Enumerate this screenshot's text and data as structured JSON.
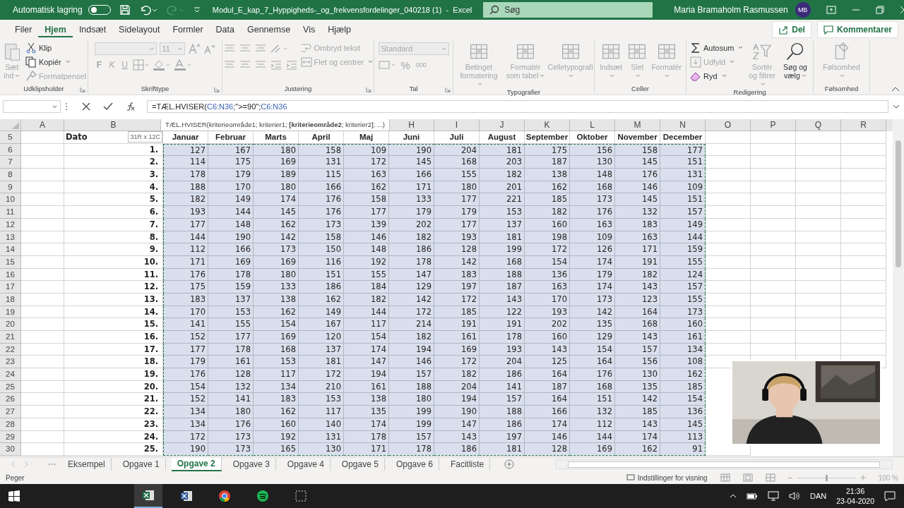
{
  "titlebar": {
    "autosave_label": "Automatisk lagring",
    "autosave_on": false,
    "title": "Modul_E_kap_7_Hyppigheds-_og_frekvensfordelinger_040218 (1)  -  Excel",
    "search_placeholder": "Søg",
    "user": "Maria Bramaholm Rasmussen",
    "avatar": "MB"
  },
  "tabs": [
    {
      "label": "Filer",
      "selected": false
    },
    {
      "label": "Hjem",
      "selected": true
    },
    {
      "label": "Indsæt",
      "selected": false
    },
    {
      "label": "Sidelayout",
      "selected": false
    },
    {
      "label": "Formler",
      "selected": false
    },
    {
      "label": "Data",
      "selected": false
    },
    {
      "label": "Gennemse",
      "selected": false
    },
    {
      "label": "Vis",
      "selected": false
    },
    {
      "label": "Hjælp",
      "selected": false
    }
  ],
  "share_button": "Del",
  "comments_button": "Kommentarer",
  "ribbon": [
    {
      "label": "Udklipsholder",
      "columns": [
        {
          "kind": "large-paste",
          "label": "Sæt ind",
          "disabled": true,
          "dropdown": true
        },
        {
          "kind": "stack",
          "items": [
            {
              "kind": "cut",
              "label": "Klip",
              "disabled": false,
              "dropdown": false
            },
            {
              "kind": "copy",
              "label": "Kopiér",
              "disabled": false,
              "dropdown": true
            },
            {
              "kind": "brush",
              "label": "Formatpensel",
              "disabled": true,
              "dropdown": false
            }
          ]
        }
      ]
    },
    {
      "label": "Skrifttype",
      "columns": [
        {
          "kind": "stack",
          "items": [
            {
              "kind": "font-row",
              "value": "11",
              "disabled": true
            },
            {
              "kind": "style-row",
              "glyphs": [
                "F",
                "K",
                "U"
              ],
              "disabled": true
            }
          ]
        }
      ]
    },
    {
      "label": "Justering",
      "columns": [
        {
          "kind": "stack",
          "items": [
            {
              "kind": "align-row",
              "disabled": true
            },
            {
              "kind": "align-row",
              "disabled": true
            }
          ]
        },
        {
          "kind": "stack",
          "items": [
            {
              "kind": "wrap",
              "label": "Ombryd tekst",
              "disabled": true,
              "dropdown": false
            },
            {
              "kind": "merge",
              "label": "Flet og centrer",
              "disabled": true,
              "dropdown": true
            }
          ]
        }
      ]
    },
    {
      "label": "Tal",
      "columns": [
        {
          "kind": "stack",
          "items": [
            {
              "kind": "field",
              "value": "Standard",
              "disabled": true
            },
            {
              "kind": "number-row",
              "glyphs": [
                "%",
                "000"
              ],
              "disabled": true
            }
          ]
        }
      ]
    },
    {
      "label": "Typografier",
      "columns": [
        {
          "kind": "large",
          "label": "Betinget formatering",
          "disabled": true,
          "dropdown": true
        },
        {
          "kind": "large",
          "label": "Formatér som tabel",
          "disabled": true,
          "dropdown": true
        },
        {
          "kind": "large",
          "label": "Celletypografi",
          "disabled": true,
          "dropdown": true
        }
      ]
    },
    {
      "label": "Celler",
      "columns": [
        {
          "kind": "large",
          "label": "Indsæt",
          "disabled": true,
          "dropdown": true
        },
        {
          "kind": "large",
          "label": "Slet",
          "disabled": true,
          "dropdown": true
        },
        {
          "kind": "large",
          "label": "Formatér",
          "disabled": true,
          "dropdown": true
        }
      ]
    },
    {
      "label": "Redigering",
      "columns": [
        {
          "kind": "stack",
          "items": [
            {
              "kind": "sum",
              "label": "Autosum",
              "disabled": false,
              "dropdown": true
            },
            {
              "kind": "fill",
              "label": "Udfyld",
              "disabled": true,
              "dropdown": true
            },
            {
              "kind": "eraser",
              "label": "Ryd",
              "disabled": false,
              "dropdown": true
            }
          ]
        },
        {
          "kind": "large-sort",
          "label": "Sortér og filtrer",
          "disabled": true,
          "dropdown": true
        },
        {
          "kind": "large-search",
          "label": "Søg og vælg",
          "disabled": false,
          "dropdown": true
        }
      ]
    },
    {
      "label": "Følsomhed",
      "columns": [
        {
          "kind": "large-tag",
          "label": "Følsomhed",
          "disabled": true,
          "dropdown": true
        }
      ]
    }
  ],
  "formula_bar": {
    "formula": [
      {
        "text": "=TÆL.HVISER(",
        "kind": "plain"
      },
      {
        "text": "C6:N36",
        "kind": "ref"
      },
      {
        "text": ";\">=90\";",
        "kind": "plain"
      },
      {
        "text": "C6:N36",
        "kind": "ref"
      }
    ],
    "tooltip": "TÆL.HVISER(kriterieområde1; kriterier1; **[kriterieområde2**; kriterier2]; ...)"
  },
  "column_headers_left": [
    "A",
    "B"
  ],
  "column_headers_right": [
    "H",
    "I",
    "J",
    "K",
    "L",
    "M",
    "N",
    "O",
    "P",
    "Q",
    "R"
  ],
  "header_row": {
    "num": "5",
    "label": "Dato",
    "size_hint": "31R x 12C",
    "months": [
      "Januar",
      "Februar",
      "Marts",
      "April",
      "Maj",
      "Juni",
      "Juli",
      "August",
      "September",
      "Oktober",
      "November",
      "December"
    ]
  },
  "rows": [
    {
      "num": "6",
      "day": "1.",
      "values": [
        "127",
        "167",
        "180",
        "158",
        "109",
        "190",
        "204",
        "181",
        "175",
        "156",
        "158",
        "177"
      ]
    },
    {
      "num": "7",
      "day": "2.",
      "values": [
        "114",
        "175",
        "169",
        "131",
        "172",
        "145",
        "168",
        "203",
        "187",
        "130",
        "145",
        "151"
      ]
    },
    {
      "num": "8",
      "day": "3.",
      "values": [
        "178",
        "179",
        "189",
        "115",
        "163",
        "166",
        "155",
        "182",
        "138",
        "148",
        "176",
        "131"
      ]
    },
    {
      "num": "9",
      "day": "4.",
      "values": [
        "188",
        "170",
        "180",
        "166",
        "162",
        "171",
        "180",
        "201",
        "162",
        "168",
        "146",
        "109"
      ]
    },
    {
      "num": "10",
      "day": "5.",
      "values": [
        "182",
        "149",
        "174",
        "176",
        "158",
        "133",
        "177",
        "221",
        "185",
        "173",
        "145",
        "151"
      ]
    },
    {
      "num": "11",
      "day": "6.",
      "values": [
        "193",
        "144",
        "145",
        "176",
        "177",
        "179",
        "179",
        "153",
        "182",
        "176",
        "132",
        "157"
      ]
    },
    {
      "num": "12",
      "day": "7.",
      "values": [
        "177",
        "148",
        "162",
        "173",
        "139",
        "202",
        "177",
        "137",
        "160",
        "163",
        "183",
        "149"
      ]
    },
    {
      "num": "13",
      "day": "8.",
      "values": [
        "144",
        "190",
        "142",
        "158",
        "146",
        "182",
        "193",
        "181",
        "198",
        "109",
        "163",
        "144"
      ]
    },
    {
      "num": "14",
      "day": "9.",
      "values": [
        "112",
        "166",
        "173",
        "150",
        "148",
        "186",
        "128",
        "199",
        "172",
        "126",
        "171",
        "159"
      ]
    },
    {
      "num": "15",
      "day": "10.",
      "values": [
        "171",
        "169",
        "169",
        "116",
        "192",
        "178",
        "142",
        "168",
        "154",
        "174",
        "191",
        "155"
      ]
    },
    {
      "num": "16",
      "day": "11.",
      "values": [
        "176",
        "178",
        "180",
        "151",
        "155",
        "147",
        "183",
        "188",
        "136",
        "179",
        "182",
        "124"
      ]
    },
    {
      "num": "17",
      "day": "12.",
      "values": [
        "175",
        "159",
        "133",
        "186",
        "184",
        "129",
        "197",
        "187",
        "163",
        "174",
        "143",
        "157"
      ]
    },
    {
      "num": "18",
      "day": "13.",
      "values": [
        "183",
        "137",
        "138",
        "162",
        "182",
        "142",
        "172",
        "143",
        "170",
        "173",
        "123",
        "155"
      ]
    },
    {
      "num": "19",
      "day": "14.",
      "values": [
        "170",
        "153",
        "162",
        "149",
        "144",
        "172",
        "185",
        "122",
        "193",
        "142",
        "164",
        "173"
      ]
    },
    {
      "num": "20",
      "day": "15.",
      "values": [
        "141",
        "155",
        "154",
        "167",
        "117",
        "214",
        "191",
        "191",
        "202",
        "135",
        "168",
        "160"
      ]
    },
    {
      "num": "21",
      "day": "16.",
      "values": [
        "152",
        "177",
        "169",
        "120",
        "154",
        "182",
        "161",
        "178",
        "160",
        "129",
        "143",
        "161"
      ]
    },
    {
      "num": "22",
      "day": "17.",
      "values": [
        "177",
        "178",
        "168",
        "137",
        "174",
        "194",
        "169",
        "193",
        "143",
        "154",
        "157",
        "134"
      ]
    },
    {
      "num": "23",
      "day": "18.",
      "values": [
        "179",
        "161",
        "153",
        "181",
        "147",
        "146",
        "172",
        "204",
        "125",
        "164",
        "156",
        "108"
      ]
    },
    {
      "num": "24",
      "day": "19.",
      "values": [
        "176",
        "128",
        "117",
        "172",
        "194",
        "157",
        "182",
        "186",
        "164",
        "176",
        "130",
        "162"
      ]
    },
    {
      "num": "25",
      "day": "20.",
      "values": [
        "154",
        "132",
        "134",
        "210",
        "161",
        "188",
        "204",
        "141",
        "187",
        "168",
        "135",
        "185"
      ]
    },
    {
      "num": "26",
      "day": "21.",
      "values": [
        "152",
        "141",
        "183",
        "153",
        "138",
        "180",
        "194",
        "157",
        "164",
        "151",
        "142",
        "154"
      ]
    },
    {
      "num": "27",
      "day": "22.",
      "values": [
        "134",
        "180",
        "162",
        "117",
        "135",
        "199",
        "190",
        "188",
        "166",
        "132",
        "185",
        "136"
      ]
    },
    {
      "num": "28",
      "day": "23.",
      "values": [
        "134",
        "176",
        "160",
        "140",
        "174",
        "199",
        "147",
        "186",
        "174",
        "112",
        "143",
        "145"
      ]
    },
    {
      "num": "29",
      "day": "24.",
      "values": [
        "172",
        "173",
        "192",
        "131",
        "178",
        "157",
        "143",
        "197",
        "146",
        "144",
        "174",
        "113"
      ]
    },
    {
      "num": "30",
      "day": "25.",
      "values": [
        "190",
        "173",
        "165",
        "130",
        "171",
        "178",
        "186",
        "181",
        "128",
        "169",
        "162",
        "91"
      ]
    }
  ],
  "webcam": {
    "kind": "picture"
  },
  "sheet_tabs": [
    {
      "label": "Eksempel",
      "selected": false
    },
    {
      "label": "Opgave 1",
      "selected": false
    },
    {
      "label": "Opgave 2",
      "selected": true
    },
    {
      "label": "Opgave 3",
      "selected": false
    },
    {
      "label": "Opgave 4",
      "selected": false
    },
    {
      "label": "Opgave 5",
      "selected": false
    },
    {
      "label": "Opgave 6",
      "selected": false
    },
    {
      "label": "Facitliste",
      "selected": false
    }
  ],
  "status_bar": {
    "mode": "Peger",
    "view_settings": "Indstillinger for visning",
    "zoom_slider": {
      "level": 0.5
    },
    "zoom": "100 %"
  },
  "taskbar": {
    "apps": [
      {
        "kind": "excel",
        "active": true
      },
      {
        "kind": "word",
        "active": false
      },
      {
        "kind": "chrome",
        "active": false
      },
      {
        "kind": "spotify",
        "active": false
      },
      {
        "kind": "snip",
        "active": false
      }
    ],
    "language": "DAN",
    "time": "21:36",
    "date": "23-04-2020"
  }
}
